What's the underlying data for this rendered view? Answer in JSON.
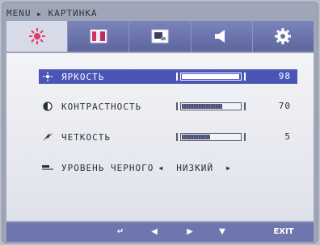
{
  "breadcrumb": {
    "root": "MENU",
    "separator": "▶",
    "current": "КАРТИНКА"
  },
  "tabs": [
    {
      "icon": "brightness-icon",
      "active": true
    },
    {
      "icon": "color-icon",
      "active": false
    },
    {
      "icon": "picture-icon",
      "active": false
    },
    {
      "icon": "audio-icon",
      "active": false
    },
    {
      "icon": "settings-gear-icon",
      "active": false
    }
  ],
  "menu": {
    "brightness": {
      "label": "ЯРКОСТЬ",
      "value": "98",
      "level": 0.98
    },
    "contrast": {
      "label": "КОНТРАСТНОСТЬ",
      "value": "70",
      "level": 0.7
    },
    "sharpness": {
      "label": "ЧЕТКОСТЬ",
      "value": "5",
      "level": 0.5
    },
    "black_level": {
      "label": "УРОВЕНЬ ЧЕРНОГО",
      "left_arrow": "◀",
      "value": "НИЗКИЙ",
      "right_arrow": "▶"
    }
  },
  "footer": {
    "back": "↵",
    "left": "◀",
    "right": "▶",
    "down": "▼",
    "exit": "EXIT"
  },
  "colors": {
    "selected_row": "#4b55b5",
    "tab_bar": "#6a73a8",
    "footer": "#6e77ad"
  }
}
